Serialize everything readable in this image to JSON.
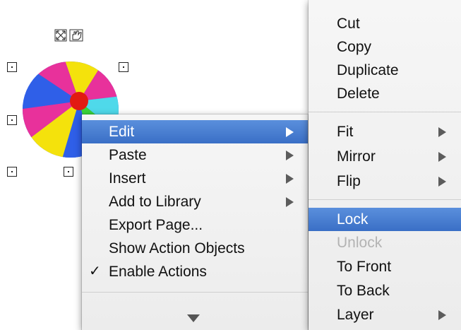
{
  "context_menu": {
    "items": [
      {
        "label": "Edit",
        "submenu": true,
        "highlighted": true
      },
      {
        "label": "Paste",
        "submenu": true
      },
      {
        "label": "Insert",
        "submenu": true
      },
      {
        "label": "Add to Library",
        "submenu": true
      },
      {
        "label": "Export Page..."
      },
      {
        "label": "Show Action Objects"
      },
      {
        "label": "Enable Actions",
        "checked": true,
        "check_mark": "✓"
      }
    ],
    "scroll_more": "scroll-down-arrow-icon"
  },
  "edit_submenu": {
    "items": [
      {
        "label": "Cut"
      },
      {
        "label": "Copy"
      },
      {
        "label": "Duplicate"
      },
      {
        "label": "Delete"
      },
      {
        "label": "Fit",
        "submenu": true
      },
      {
        "label": "Mirror",
        "submenu": true
      },
      {
        "label": "Flip",
        "submenu": true
      },
      {
        "label": "Lock",
        "highlighted": true
      },
      {
        "label": "Unlock",
        "disabled": true
      },
      {
        "label": "To Front"
      },
      {
        "label": "To Back"
      },
      {
        "label": "Layer",
        "submenu": true
      }
    ]
  },
  "canvas": {
    "object": "beach-ball-image",
    "colors": {
      "yellow": "#f4e20c",
      "magenta": "#e8319b",
      "blue": "#2f5fe8",
      "green": "#3ad43a",
      "cyan": "#4fd9ea",
      "red": "#e21a12"
    },
    "tool_icons": [
      "resize-icon",
      "hand-icon"
    ]
  },
  "colors": {
    "highlight": "#3f74cc",
    "menu_bg": "#f2f2f2",
    "disabled_text": "#b3b3b3"
  }
}
